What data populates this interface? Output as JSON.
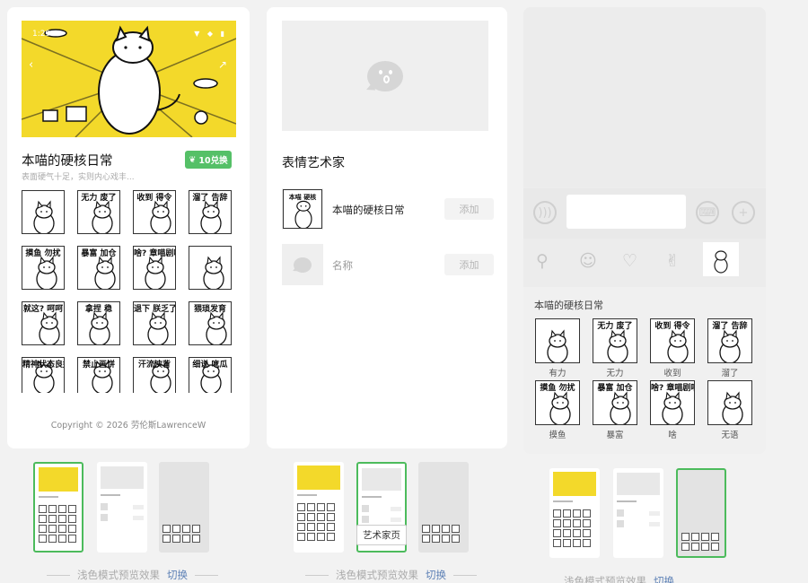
{
  "detail_page": {
    "banner": {
      "time": "1:29",
      "status_icons": "▼ ◆ ▮"
    },
    "title": "本喵的硬核日常",
    "subtitle": "表面硬气十足，实则内心戏丰...",
    "redeem_button": "10兑换",
    "stickers": [
      {
        "caption": ""
      },
      {
        "caption": "无力 废了"
      },
      {
        "caption": "收到 得令"
      },
      {
        "caption": "溜了 告辞"
      },
      {
        "caption": "摸鱼 勿扰"
      },
      {
        "caption": "暴富 加仓"
      },
      {
        "caption": "啥? 章喵剧喵"
      },
      {
        "caption": ""
      },
      {
        "caption": "就这? 呵呵"
      },
      {
        "caption": "拿捏 稳"
      },
      {
        "caption": "退下 朕乏了"
      },
      {
        "caption": "猥琐发育"
      },
      {
        "caption": "精神状态良好 啊"
      },
      {
        "caption": "禁止画饼"
      },
      {
        "caption": "汗流浃背"
      },
      {
        "caption": "细说 吃瓜"
      }
    ],
    "copyright": "Copyright © 2026 劳伦斯LawrenceW"
  },
  "artist_page": {
    "title": "表情艺术家",
    "rows": [
      {
        "name": "本喵的硬核日常",
        "button": "添加"
      },
      {
        "name": "名称",
        "button": "添加"
      }
    ]
  },
  "chat_page": {
    "pack_name": "本喵的硬核日常",
    "stickers": [
      {
        "caption": "",
        "label": "有力"
      },
      {
        "caption": "无力 废了",
        "label": "无力"
      },
      {
        "caption": "收到 得令",
        "label": "收到"
      },
      {
        "caption": "溜了 告辞",
        "label": "溜了"
      },
      {
        "caption": "摸鱼 勿扰",
        "label": "摸鱼"
      },
      {
        "caption": "暴富 加仓",
        "label": "暴富"
      },
      {
        "caption": "啥? 章喵剧喵",
        "label": "啥"
      },
      {
        "caption": "",
        "label": "无语"
      }
    ]
  },
  "previews": {
    "tooltip": "艺术家页",
    "footer_text": "浅色模式预览效果",
    "switch_label": "切换"
  },
  "colors": {
    "accent_green": "#55c067",
    "banner_yellow": "#f3d92a",
    "link_blue": "#5b7fb5"
  }
}
